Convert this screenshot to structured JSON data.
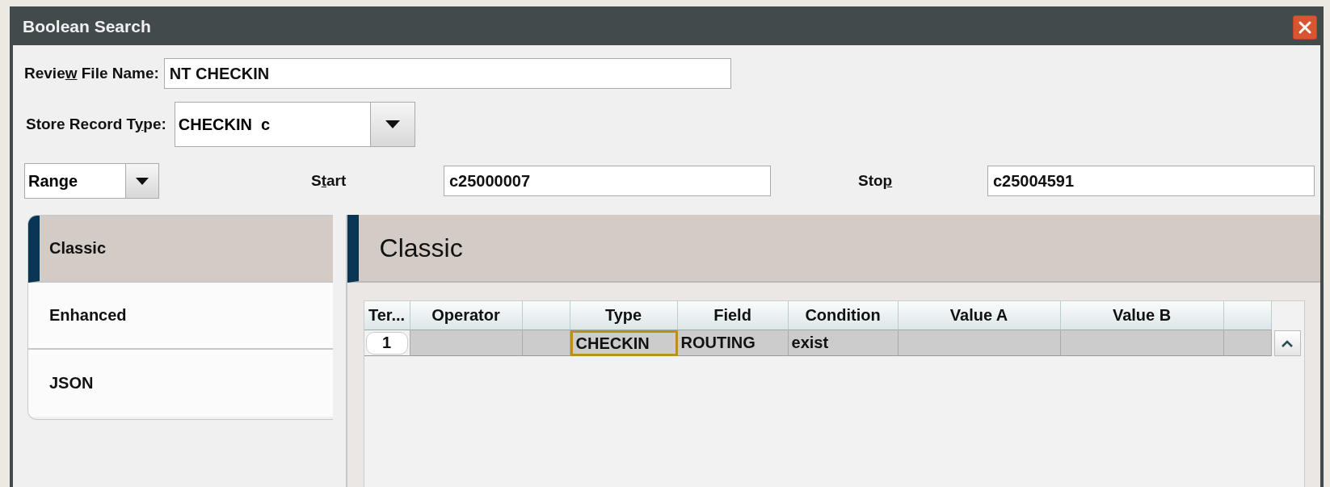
{
  "window": {
    "title": "Boolean Search"
  },
  "review_file_name": {
    "label": {
      "pre": "Revie",
      "key": "w",
      "post": " File Name:"
    },
    "value": "NT CHECKIN"
  },
  "store_record_type": {
    "label": {
      "pre": "Store Record T",
      "key": "y",
      "post": "pe:"
    },
    "value": "CHECKIN  c"
  },
  "range": {
    "value": "Range"
  },
  "start": {
    "label": {
      "pre": "S",
      "key": "t",
      "post": "art"
    },
    "value": "c25000007"
  },
  "stop": {
    "label": {
      "pre": "Sto",
      "key": "p"
    },
    "value": "c25004591"
  },
  "side_tabs": [
    {
      "label": "Classic",
      "selected": true
    },
    {
      "label": "Enhanced",
      "selected": false
    },
    {
      "label": "JSON",
      "selected": false
    }
  ],
  "panel": {
    "title": "Classic"
  },
  "table": {
    "columns": [
      {
        "label": "Ter..."
      },
      {
        "label": "Operator"
      },
      {},
      {
        "label": "Type"
      },
      {
        "label": "Field"
      },
      {
        "label": "Condition"
      },
      {
        "label": "Value A"
      },
      {
        "label": "Value B"
      },
      {}
    ],
    "rows": [
      {
        "cells": [
          {
            "kind": "number",
            "text": "1",
            "selected": false
          },
          {
            "selected": false
          },
          {
            "selected": false
          },
          {
            "text": "CHECKIN",
            "selected": true
          },
          {
            "text": "ROUTING",
            "selected": false
          },
          {
            "text": "exist",
            "selected": false
          },
          {
            "selected": false
          },
          {
            "selected": false
          },
          {
            "selected": false
          }
        ]
      }
    ]
  }
}
